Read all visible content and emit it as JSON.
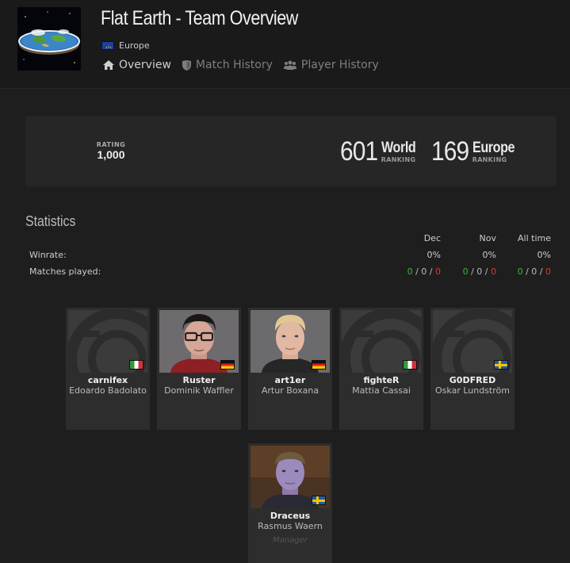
{
  "header": {
    "title": "Flat Earth - Team Overview",
    "region": "Europe",
    "nav": [
      {
        "label": "Overview",
        "icon": "home-icon",
        "active": true
      },
      {
        "label": "Match History",
        "icon": "shield-icon",
        "active": false
      },
      {
        "label": "Player History",
        "icon": "users-icon",
        "active": false
      }
    ]
  },
  "rating": {
    "label": "RATING",
    "value": "1,000",
    "world_rank": "601",
    "world_label": "World",
    "world_sub": "RANKING",
    "region_rank": "169",
    "region_label": "Europe",
    "region_sub": "RANKING"
  },
  "statistics": {
    "title": "Statistics",
    "columns": [
      "Dec",
      "Nov",
      "All time"
    ],
    "winrate_label": "Winrate:",
    "winrate": [
      "0%",
      "0%",
      "0%"
    ],
    "matches_label": "Matches played:",
    "matches": [
      {
        "w": "0",
        "d": "0",
        "l": "0",
        "sep": "/"
      },
      {
        "w": "0",
        "d": "0",
        "l": "0",
        "sep": "/"
      },
      {
        "w": "0",
        "d": "0",
        "l": "0",
        "sep": "/"
      }
    ]
  },
  "players": [
    {
      "nick": "carnifex",
      "name": "Edoardo Badolato",
      "flag": "italy",
      "photo": "placeholder",
      "role": ""
    },
    {
      "nick": "Ruster",
      "name": "Dominik Waffler",
      "flag": "germany",
      "photo": "person-glasses",
      "role": ""
    },
    {
      "nick": "art1er",
      "name": "Artur Boxana",
      "flag": "germany",
      "photo": "person-blond",
      "role": ""
    },
    {
      "nick": "fighteR",
      "name": "Mattia Cassai",
      "flag": "italy",
      "photo": "placeholder",
      "role": ""
    },
    {
      "nick": "G0DFRED",
      "name": "Oskar Lundström",
      "flag": "sweden",
      "photo": "placeholder",
      "role": ""
    },
    {
      "nick": "Draceus",
      "name": "Rasmus Waern",
      "flag": "sweden",
      "photo": "person-dark",
      "role": "Manager"
    }
  ],
  "colors": {
    "win": "#3bb73b",
    "loss": "#d63b2f",
    "draw": "#bbbbbb"
  }
}
